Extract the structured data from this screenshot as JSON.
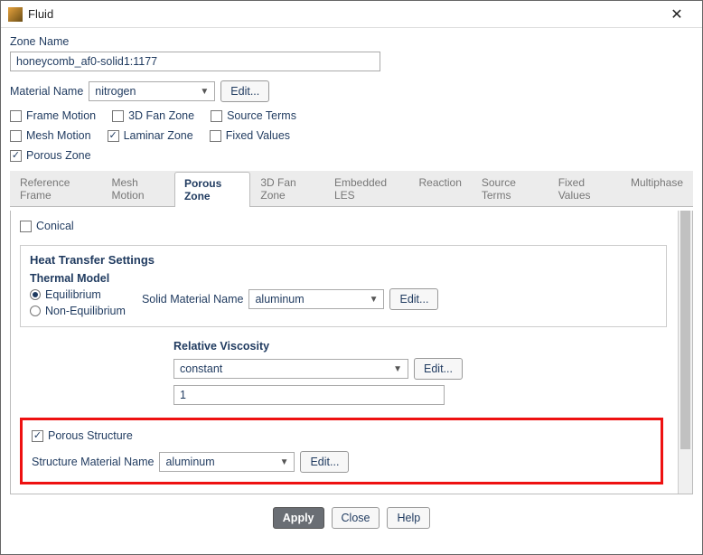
{
  "window": {
    "title": "Fluid"
  },
  "zone": {
    "name_label": "Zone Name",
    "name_value": "honeycomb_af0-solid1:1177"
  },
  "material": {
    "label": "Material Name",
    "value": "nitrogen",
    "edit": "Edit..."
  },
  "options": {
    "frame_motion": {
      "label": "Frame Motion",
      "checked": false
    },
    "fan_zone": {
      "label": "3D Fan Zone",
      "checked": false
    },
    "source_terms": {
      "label": "Source Terms",
      "checked": false
    },
    "mesh_motion": {
      "label": "Mesh Motion",
      "checked": false
    },
    "laminar_zone": {
      "label": "Laminar Zone",
      "checked": true
    },
    "fixed_values": {
      "label": "Fixed Values",
      "checked": false
    },
    "porous_zone": {
      "label": "Porous Zone",
      "checked": true
    }
  },
  "tabs": [
    {
      "label": "Reference Frame",
      "active": false
    },
    {
      "label": "Mesh Motion",
      "active": false
    },
    {
      "label": "Porous Zone",
      "active": true
    },
    {
      "label": "3D Fan Zone",
      "active": false
    },
    {
      "label": "Embedded LES",
      "active": false
    },
    {
      "label": "Reaction",
      "active": false
    },
    {
      "label": "Source Terms",
      "active": false
    },
    {
      "label": "Fixed Values",
      "active": false
    },
    {
      "label": "Multiphase",
      "active": false
    }
  ],
  "porous": {
    "conical": {
      "label": "Conical",
      "checked": false
    },
    "heat_transfer": {
      "title": "Heat Transfer Settings",
      "thermal_label": "Thermal Model",
      "equilibrium": "Equilibrium",
      "non_equilibrium": "Non-Equilibrium",
      "thermal_selected": "equilibrium",
      "solid_label": "Solid Material Name",
      "solid_value": "aluminum",
      "edit": "Edit..."
    },
    "relative_viscosity": {
      "title": "Relative Viscosity",
      "method": "constant",
      "edit": "Edit...",
      "value": "1"
    },
    "structure": {
      "checkbox_label": "Porous Structure",
      "checked": true,
      "material_label": "Structure Material Name",
      "material_value": "aluminum",
      "edit": "Edit..."
    }
  },
  "footer": {
    "apply": "Apply",
    "close": "Close",
    "help": "Help"
  }
}
